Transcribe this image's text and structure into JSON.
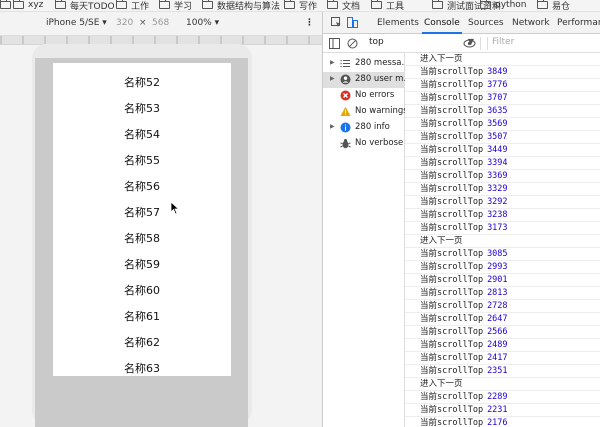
{
  "bookmarks": [
    {
      "label": ""
    },
    {
      "label": "xyz"
    },
    {
      "label": "每天TODO"
    },
    {
      "label": "工作"
    },
    {
      "label": "学习"
    },
    {
      "label": "数据结构与算法"
    },
    {
      "label": "写作"
    },
    {
      "label": "文档"
    },
    {
      "label": "工具"
    },
    {
      "label": "测试面试资料"
    },
    {
      "label": "python"
    },
    {
      "label": "易仓"
    }
  ],
  "device_toolbar": {
    "device": "iPhone 5/SE ▾",
    "width": "320",
    "times": "×",
    "height": "568",
    "zoom": "100% ▾",
    "more": "⋮"
  },
  "list_items": [
    "名称52",
    "名称53",
    "名称54",
    "名称55",
    "名称56",
    "名称57",
    "名称58",
    "名称59",
    "名称60",
    "名称61",
    "名称62",
    "名称63"
  ],
  "devtools": {
    "tabs": [
      "Elements",
      "Console",
      "Sources",
      "Network",
      "Performance"
    ],
    "active_tab": "Console",
    "context": "top",
    "filter_placeholder": "Filter",
    "sidebar": [
      {
        "label": "280 messa...",
        "icon": "list-icon",
        "expandable": true
      },
      {
        "label": "280 user m...",
        "icon": "user-icon",
        "expandable": true,
        "selected": true
      },
      {
        "label": "No errors",
        "icon": "error-icon",
        "expandable": false
      },
      {
        "label": "No warnings",
        "icon": "warning-icon",
        "expandable": false
      },
      {
        "label": "280 info",
        "icon": "info-icon",
        "expandable": true
      },
      {
        "label": "No verbose",
        "icon": "bug-icon",
        "expandable": false
      }
    ]
  },
  "console_logs": [
    {
      "text": "进入下一页"
    },
    {
      "text": "当前scrollTop",
      "value": "3849"
    },
    {
      "text": "当前scrollTop",
      "value": "3776"
    },
    {
      "text": "当前scrollTop",
      "value": "3707"
    },
    {
      "text": "当前scrollTop",
      "value": "3635"
    },
    {
      "text": "当前scrollTop",
      "value": "3569"
    },
    {
      "text": "当前scrollTop",
      "value": "3507"
    },
    {
      "text": "当前scrollTop",
      "value": "3449"
    },
    {
      "text": "当前scrollTop",
      "value": "3394"
    },
    {
      "text": "当前scrollTop",
      "value": "3369"
    },
    {
      "text": "当前scrollTop",
      "value": "3329"
    },
    {
      "text": "当前scrollTop",
      "value": "3292"
    },
    {
      "text": "当前scrollTop",
      "value": "3238"
    },
    {
      "text": "当前scrollTop",
      "value": "3173"
    },
    {
      "text": "进入下一页"
    },
    {
      "text": "当前scrollTop",
      "value": "3085"
    },
    {
      "text": "当前scrollTop",
      "value": "2993"
    },
    {
      "text": "当前scrollTop",
      "value": "2901"
    },
    {
      "text": "当前scrollTop",
      "value": "2813"
    },
    {
      "text": "当前scrollTop",
      "value": "2728"
    },
    {
      "text": "当前scrollTop",
      "value": "2647"
    },
    {
      "text": "当前scrollTop",
      "value": "2566"
    },
    {
      "text": "当前scrollTop",
      "value": "2489"
    },
    {
      "text": "当前scrollTop",
      "value": "2417"
    },
    {
      "text": "当前scrollTop",
      "value": "2351"
    },
    {
      "text": "进入下一页"
    },
    {
      "text": "当前scrollTop",
      "value": "2289"
    },
    {
      "text": "当前scrollTop",
      "value": "2231"
    },
    {
      "text": "当前scrollTop",
      "value": "2176"
    }
  ],
  "colors": {
    "accent": "#1a73e8",
    "number": "#1c00cf",
    "device_frame": "#cacaca"
  }
}
